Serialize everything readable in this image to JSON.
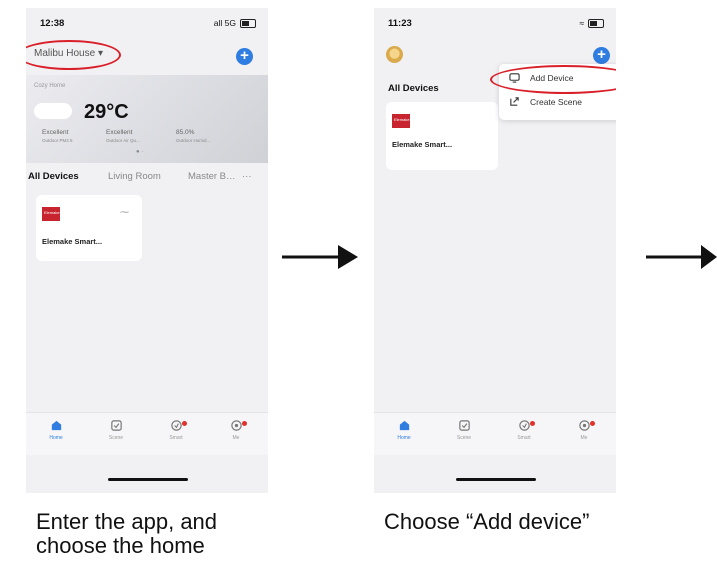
{
  "colors": {
    "accent": "#2f7de1",
    "highlight_ring": "#d9202a",
    "brand_logo": "#c8242f"
  },
  "step1": {
    "status_time": "12:38",
    "status_signal": "all 5G",
    "home_name": "Malibu House",
    "weather": {
      "label": "Cozy Home",
      "temperature": "29°C",
      "items": [
        {
          "value": "Excellent",
          "label": "Outdoor PM2.5"
        },
        {
          "value": "Excellent",
          "label": "Outdoor Air Qu..."
        },
        {
          "value": "85.0%",
          "label": "Outdoor Humid..."
        }
      ]
    },
    "tabs": [
      "All Devices",
      "Living Room",
      "Master B…"
    ],
    "more": "···",
    "device": {
      "logo_text": "Elemake",
      "name": "Elemake Smart..."
    },
    "nav": [
      {
        "icon": "home-icon",
        "label": "Home"
      },
      {
        "icon": "scene-icon",
        "label": "Scene"
      },
      {
        "icon": "smart-icon",
        "label": "Smart"
      },
      {
        "icon": "me-icon",
        "label": "Me"
      }
    ]
  },
  "step2": {
    "status_time": "11:23",
    "all_devices": "All Devices",
    "menu": [
      {
        "icon": "add-device-icon",
        "label": "Add Device"
      },
      {
        "icon": "create-scene-icon",
        "label": "Create Scene"
      }
    ],
    "device": {
      "logo_text": "Elemake",
      "name": "Elemake Smart..."
    },
    "nav": [
      {
        "icon": "home-icon",
        "label": "Home"
      },
      {
        "icon": "scene-icon",
        "label": "Scene"
      },
      {
        "icon": "smart-icon",
        "label": "Smart"
      },
      {
        "icon": "me-icon",
        "label": "Me"
      }
    ]
  },
  "captions": {
    "step1_line1": "Enter the app, and",
    "step1_line2": "choose the home",
    "step2": "Choose “Add device”"
  }
}
